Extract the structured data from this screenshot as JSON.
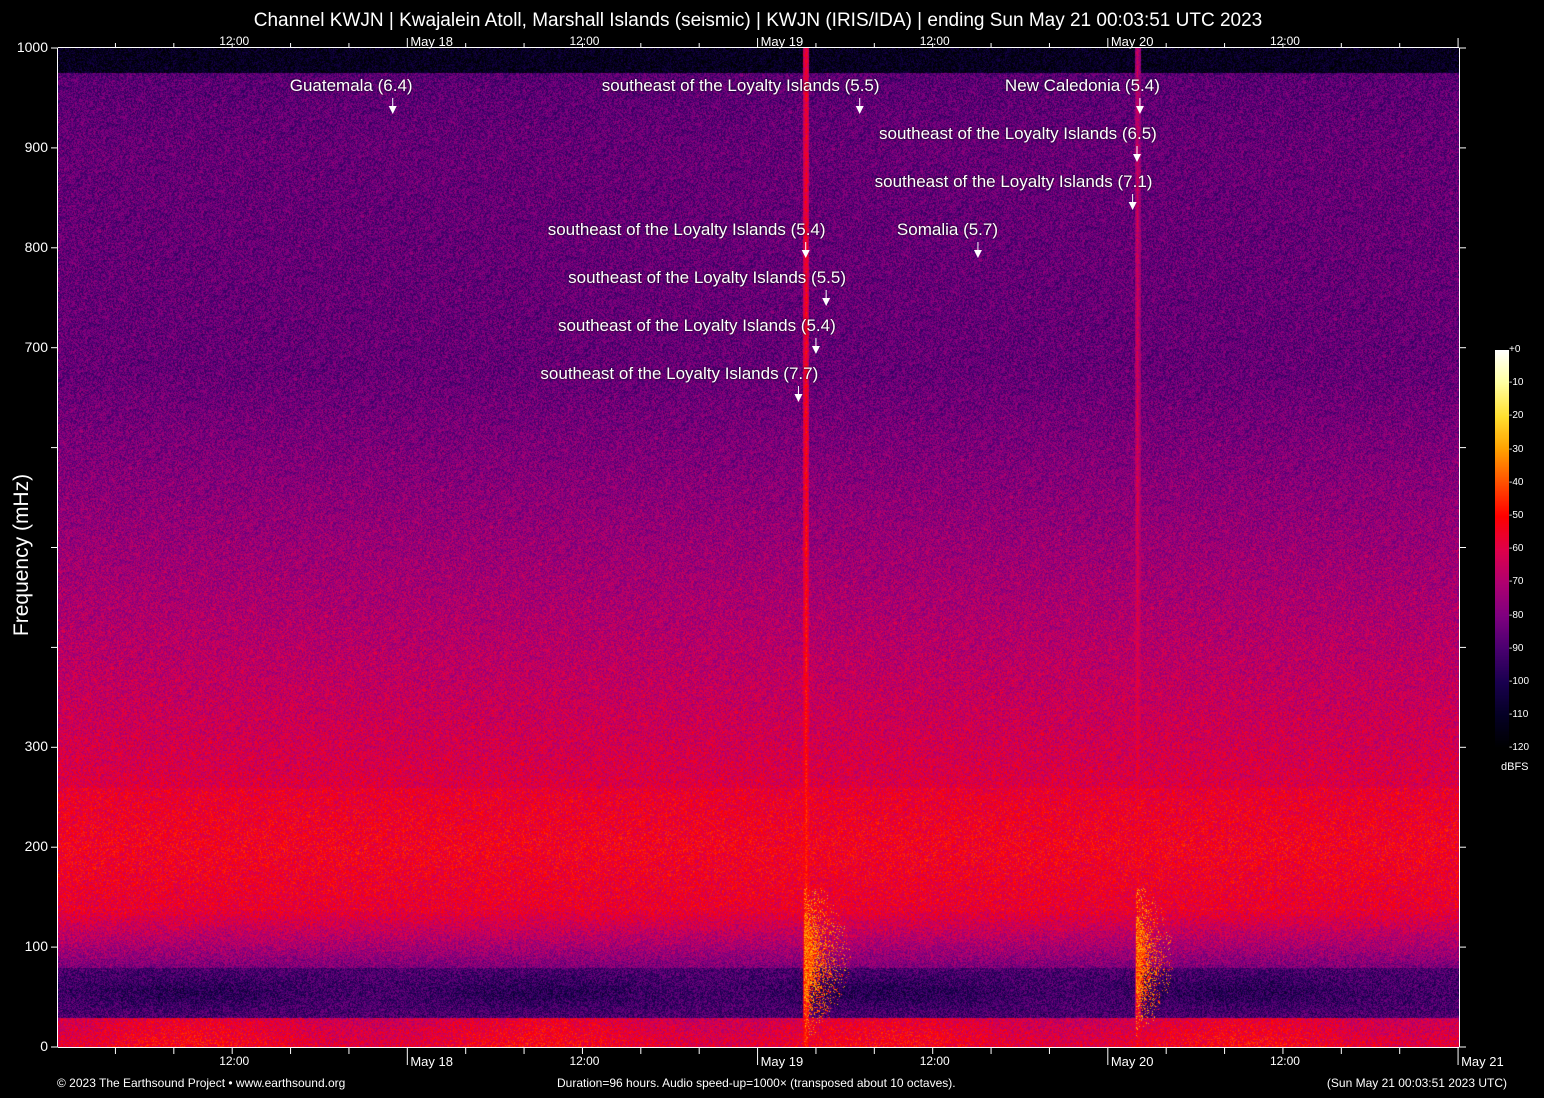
{
  "title": "Channel KWJN | Kwajalein Atoll, Marshall Islands (seismic) | KWJN (IRIS/IDA) | ending Sun May 21 00:03:51 UTC 2023",
  "footer": {
    "copyright": "© 2023 The Earthsound Project • www.earthsound.org",
    "duration": "Duration=96 hours. Audio speed-up=1000× (transposed about 10 octaves).",
    "end_time": "(Sun May 21 00:03:51 2023 UTC)"
  },
  "chart_data": {
    "type": "heatmap",
    "title": "Channel KWJN | Kwajalein Atoll, Marshall Islands (seismic) | KWJN (IRIS/IDA) | ending Sun May 21 00:03:51 UTC 2023",
    "xlabel": "",
    "ylabel": "Frequency (mHz)",
    "x_unit": "hours since May 17 00:00 UTC",
    "xlim": [
      0.064,
      96.064
    ],
    "ylim": [
      0,
      1000
    ],
    "y_ticks": [
      0,
      100,
      200,
      300,
      400,
      500,
      600,
      700,
      800,
      900,
      1000
    ],
    "y_tick_labels": [
      "0",
      "100",
      "200",
      "300",
      "",
      "",
      "",
      "700",
      "800",
      "900",
      "1000"
    ],
    "x_tick_labels": [
      {
        "hour": 12,
        "label": "12:00"
      },
      {
        "hour": 24,
        "label": "May 18"
      },
      {
        "hour": 36,
        "label": "12:00"
      },
      {
        "hour": 48,
        "label": "May 19"
      },
      {
        "hour": 60,
        "label": "12:00"
      },
      {
        "hour": 72,
        "label": "May 20"
      },
      {
        "hour": 84,
        "label": "12:00"
      },
      {
        "hour": 96,
        "label": "May 21"
      }
    ],
    "colorbar": {
      "unit": "dBFS",
      "range": [
        -120,
        0
      ],
      "tick_labels": [
        "+0",
        "-10",
        "-20",
        "-30",
        "-40",
        "-50",
        "-60",
        "-70",
        "-80",
        "-90",
        "-100",
        "-110",
        "-120"
      ],
      "colors": [
        "#ffffff",
        "#ffffa0",
        "#ffe030",
        "#ffa000",
        "#ff5000",
        "#ff0000",
        "#e0004a",
        "#b00070",
        "#800080",
        "#4a0070",
        "#1a0050",
        "#050025",
        "#000000"
      ]
    },
    "events": [
      {
        "label": "Guatemala (6.4)",
        "hour": 23.0,
        "row": 0
      },
      {
        "label": "southeast of the Loyalty Islands (5.5)",
        "hour": 55.0,
        "row": 0
      },
      {
        "label": "New Caledonia (5.4)",
        "hour": 74.2,
        "row": 0
      },
      {
        "label": "southeast of the Loyalty Islands (6.5)",
        "hour": 74.0,
        "row": 1
      },
      {
        "label": "southeast of the Loyalty Islands (7.1)",
        "hour": 73.7,
        "row": 2
      },
      {
        "label": "southeast of the Loyalty Islands (5.4)",
        "hour": 51.3,
        "row": 3
      },
      {
        "label": "Somalia (5.7)",
        "hour": 63.1,
        "row": 3
      },
      {
        "label": "southeast of the Loyalty Islands (5.5)",
        "hour": 52.7,
        "row": 4
      },
      {
        "label": "southeast of the Loyalty Islands (5.4)",
        "hour": 52.0,
        "row": 5
      },
      {
        "label": "southeast of the Loyalty Islands (7.7)",
        "hour": 50.8,
        "row": 6
      }
    ]
  }
}
